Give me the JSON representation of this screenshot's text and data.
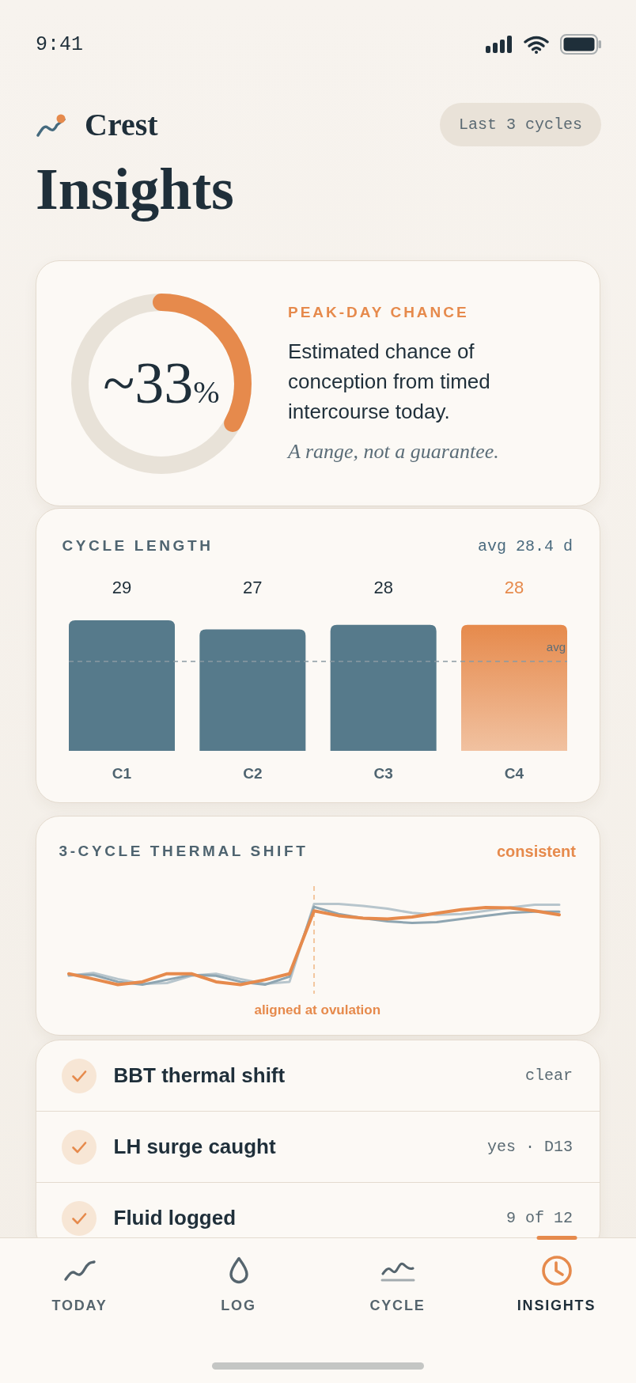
{
  "status_bar": {
    "time": "9:41"
  },
  "header": {
    "app_name": "Crest",
    "range_button": "Last 3 cycles",
    "title": "Insights"
  },
  "peak_day_card": {
    "label": "PEAK-DAY CHANCE",
    "value": "~33",
    "unit": "%",
    "level": 0.33,
    "description": "Estimated chance of conception from timed intercourse today.",
    "note": "A range, not a guarantee."
  },
  "cycle_length_card": {
    "title": "CYCLE LENGTH",
    "average": "avg 28.4 d",
    "average_line_label": "avg",
    "chart_data": {
      "type": "bar",
      "categories": [
        "C1",
        "C2",
        "C3",
        "C4"
      ],
      "series": [
        {
          "color": "#567a8b",
          "values": [
            29,
            27,
            28,
            null
          ]
        },
        {
          "color": "#e68a4c",
          "values": [
            null,
            null,
            null,
            28
          ]
        }
      ],
      "stacked": true,
      "data_labels": true
    }
  },
  "thermal_shift_card": {
    "title": "3-CYCLE THERMAL SHIFT",
    "status": "consistent",
    "marker_label": "aligned at ovulation"
  },
  "checklist": [
    {
      "label": "BBT thermal shift",
      "value": "clear",
      "checked": true
    },
    {
      "label": "LH surge caught",
      "value": "yes · D13",
      "checked": true
    },
    {
      "label": "Fluid logged",
      "value": "9 of 12",
      "checked": true
    }
  ],
  "tab_bar": [
    {
      "label": "TODAY",
      "selected": false
    },
    {
      "label": "LOG",
      "selected": false
    },
    {
      "label": "CYCLE",
      "selected": false
    },
    {
      "label": "INSIGHTS",
      "selected": true
    }
  ]
}
